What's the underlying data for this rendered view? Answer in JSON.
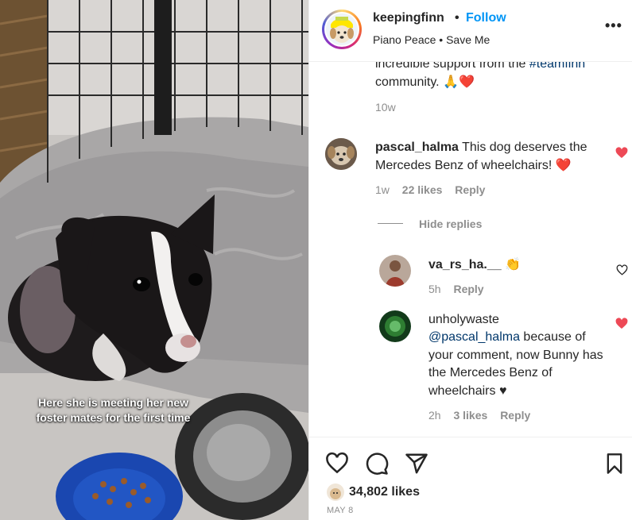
{
  "media": {
    "caption": "Here she is meeting her new foster mates for the first time"
  },
  "header": {
    "username": "keepingfinn",
    "separator": "•",
    "follow_label": "Follow",
    "song": "Piano Peace • Save Me",
    "more_icon": "more-dots-icon"
  },
  "caption_comment": {
    "text_partial": "incredible support from the",
    "hashtag": "#teamfinn",
    "text_end": "community.",
    "emojis": "🙏❤️",
    "time": "10w"
  },
  "comments": [
    {
      "username": "pascal_halma",
      "text": "This dog deserves the Mercedes Benz of wheelchairs!",
      "emoji": "❤️",
      "time": "1w",
      "likes": "22 likes",
      "reply_label": "Reply",
      "liked": true,
      "hide_replies_label": "Hide replies",
      "replies": [
        {
          "username": "va_rs_ha.__",
          "text": "",
          "emoji": "👏",
          "time": "5h",
          "reply_label": "Reply",
          "liked": false
        },
        {
          "username": "unholywaste",
          "mention": "@pascal_halma",
          "text": "because of your comment, now Bunny has the Mercedes Benz of wheelchairs",
          "emoji": "♥",
          "time": "2h",
          "likes": "3 likes",
          "reply_label": "Reply",
          "liked": true
        }
      ]
    }
  ],
  "actions": {
    "likes": "34,802 likes",
    "date": "MAY 8"
  },
  "colors": {
    "accent": "#0095f6",
    "like": "#ed4956",
    "muted": "#8e8e8e"
  }
}
